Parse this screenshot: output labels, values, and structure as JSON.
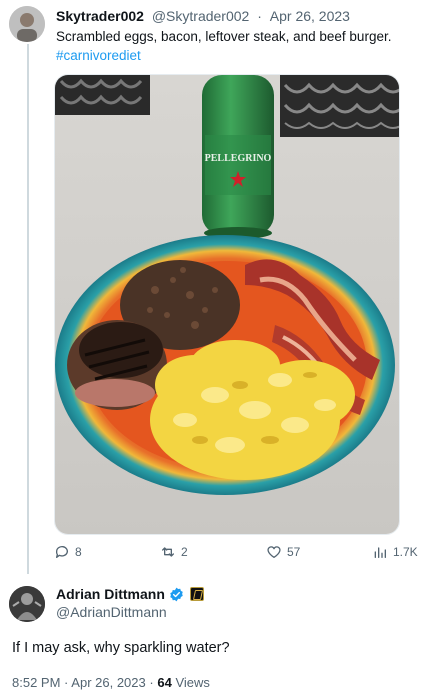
{
  "tweet": {
    "author_name": "Skytrader002",
    "handle": "@Skytrader002",
    "date": "Apr 26, 2023",
    "separator": "·",
    "text": "Scrambled eggs, bacon, leftover steak, and beef burger.",
    "hashtag": "#carnivorediet",
    "actions": {
      "reply_count": "8",
      "retweet_count": "2",
      "like_count": "57",
      "views_count": "1.7K"
    }
  },
  "reply": {
    "author_name": "Adrian Dittmann",
    "handle": "@AdrianDittmann",
    "text": "If I may ask, why sparkling water?",
    "time": "8:52 PM",
    "date": "Apr 26, 2023",
    "separator": "·",
    "views_count": "64",
    "views_label": "Views"
  },
  "photo": {
    "bottle_brand_text": "PELLEGRINO"
  },
  "colors": {
    "accent": "#1d9bf0",
    "secondary_text": "#536471",
    "primary_text": "#0f1419"
  }
}
